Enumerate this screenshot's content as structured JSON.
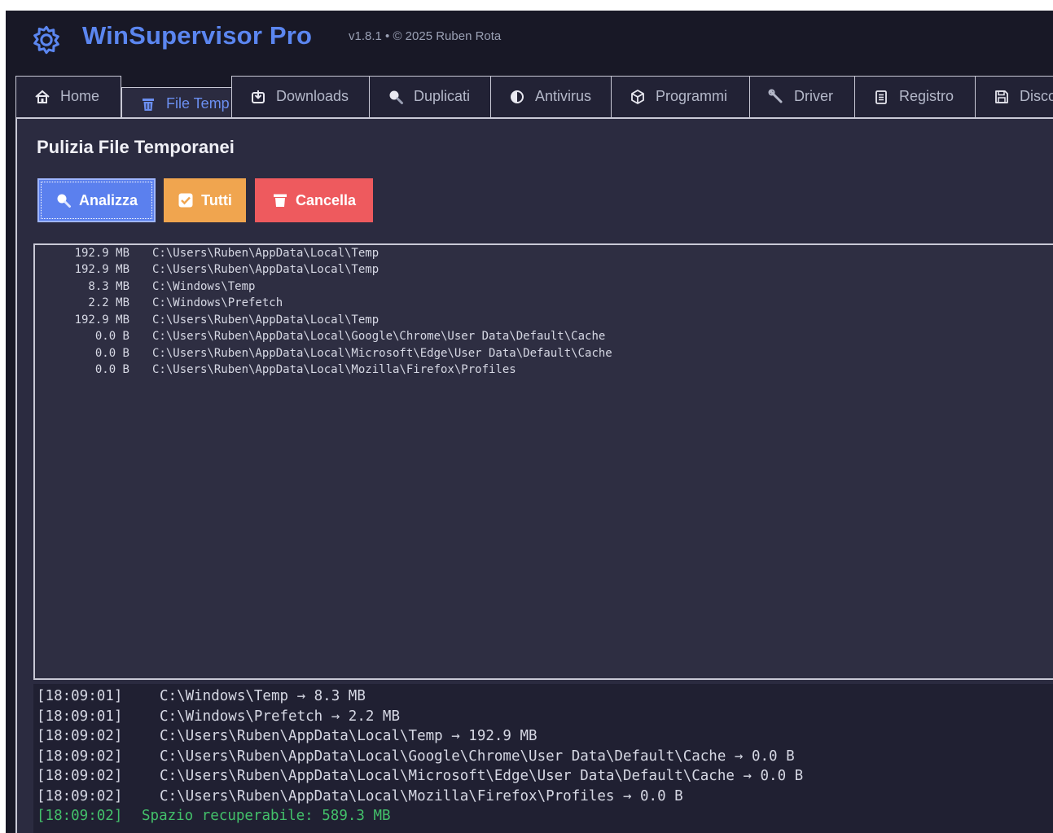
{
  "app": {
    "title": "WinSupervisor Pro",
    "version": "v1.8.1 • © 2025 Ruben Rota",
    "logo_icon": "gear-cog-icon",
    "accent_color": "#5b86f0"
  },
  "tabs": [
    {
      "label": "Home",
      "icon": "home-icon",
      "active": false
    },
    {
      "label": "File Temp",
      "icon": "trash-bin-icon",
      "active": true
    },
    {
      "label": "Downloads",
      "icon": "download-tray-icon",
      "active": false
    },
    {
      "label": "Duplicati",
      "icon": "magnifier-icon",
      "active": false
    },
    {
      "label": "Antivirus",
      "icon": "half-circle-shield-icon",
      "active": false
    },
    {
      "label": "Programmi",
      "icon": "package-box-icon",
      "active": false
    },
    {
      "label": "Driver",
      "icon": "wrench-icon",
      "active": false
    },
    {
      "label": "Registro",
      "icon": "clipboard-icon",
      "active": false
    },
    {
      "label": "Disco",
      "icon": "floppy-disk-icon",
      "active": false
    }
  ],
  "panel": {
    "title": "Pulizia File Temporanei",
    "buttons": {
      "analyze": {
        "label": "Analizza",
        "icon": "magnifier-icon",
        "color": "#5b80ee"
      },
      "all": {
        "label": "Tutti",
        "icon": "checkbox-icon",
        "color": "#f0a54f"
      },
      "delete": {
        "label": "Cancella",
        "icon": "trash-bin-icon",
        "color": "#ee5a5e"
      }
    }
  },
  "results": [
    {
      "size": "192.9 MB",
      "path": "C:\\Users\\Ruben\\AppData\\Local\\Temp"
    },
    {
      "size": "192.9 MB",
      "path": "C:\\Users\\Ruben\\AppData\\Local\\Temp"
    },
    {
      "size": "8.3 MB",
      "path": "C:\\Windows\\Temp"
    },
    {
      "size": "2.2 MB",
      "path": "C:\\Windows\\Prefetch"
    },
    {
      "size": "192.9 MB",
      "path": "C:\\Users\\Ruben\\AppData\\Local\\Temp"
    },
    {
      "size": "0.0 B",
      "path": "C:\\Users\\Ruben\\AppData\\Local\\Google\\Chrome\\User Data\\Default\\Cache"
    },
    {
      "size": "0.0 B",
      "path": "C:\\Users\\Ruben\\AppData\\Local\\Microsoft\\Edge\\User Data\\Default\\Cache"
    },
    {
      "size": "0.0 B",
      "path": "C:\\Users\\Ruben\\AppData\\Local\\Mozilla\\Firefox\\Profiles"
    }
  ],
  "log": [
    {
      "time": "[18:09:01]",
      "message": "C:\\Windows\\Temp  →  8.3 MB",
      "success": false
    },
    {
      "time": "[18:09:01]",
      "message": "C:\\Windows\\Prefetch  →  2.2 MB",
      "success": false
    },
    {
      "time": "[18:09:02]",
      "message": "C:\\Users\\Ruben\\AppData\\Local\\Temp  →  192.9 MB",
      "success": false
    },
    {
      "time": "[18:09:02]",
      "message": "C:\\Users\\Ruben\\AppData\\Local\\Google\\Chrome\\User Data\\Default\\Cache  →  0.0 B",
      "success": false
    },
    {
      "time": "[18:09:02]",
      "message": "C:\\Users\\Ruben\\AppData\\Local\\Microsoft\\Edge\\User Data\\Default\\Cache  →  0.0 B",
      "success": false
    },
    {
      "time": "[18:09:02]",
      "message": "C:\\Users\\Ruben\\AppData\\Local\\Mozilla\\Firefox\\Profiles  →  0.0 B",
      "success": false
    },
    {
      "time": "[18:09:02]",
      "message": "Spazio recuperabile: 589.3 MB",
      "success": true
    }
  ],
  "colors": {
    "background": "#181826",
    "panel": "#2b2b40",
    "log_success": "#43c06a"
  }
}
